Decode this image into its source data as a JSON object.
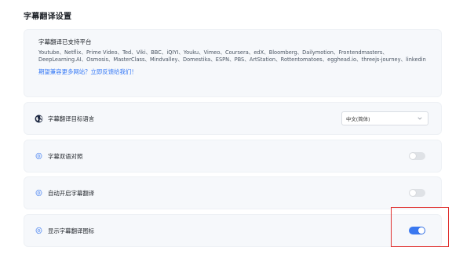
{
  "page": {
    "title": "字幕翻译设置"
  },
  "platforms": {
    "heading": "字幕翻译已支持平台",
    "list": "Youtube、Netflix、Prime Video、Ted、Viki、BBC、iQIYI、Youku、Vimeo、Coursera、edX、Bloomberg、Dailymotion、Frontendmasters、DeepLearning.AI、Osmosis、MasterClass、Mindvalley、Domestika、ESPN、PBS、ArtStation、Rottentomatoes、egghead.io、threejs-journey、linkedin",
    "feedback_link": "期望兼容更多网站？立即反馈给我们！"
  },
  "settings": [
    {
      "label": "字幕翻译目标语言",
      "icon": "globe-icon",
      "control": "select",
      "value": "中文(简体)"
    },
    {
      "label": "字幕双语对照",
      "icon": "gear-icon",
      "control": "toggle",
      "on": false
    },
    {
      "label": "自动开启字幕翻译",
      "icon": "gear-icon",
      "control": "toggle",
      "on": false
    },
    {
      "label": "显示字幕翻译图标",
      "icon": "gear-icon",
      "control": "toggle",
      "on": true
    }
  ],
  "colors": {
    "accent": "#3a78f0",
    "link": "#3478f6",
    "highlight": "#e0312f",
    "card_bg": "#f6f8fb"
  }
}
